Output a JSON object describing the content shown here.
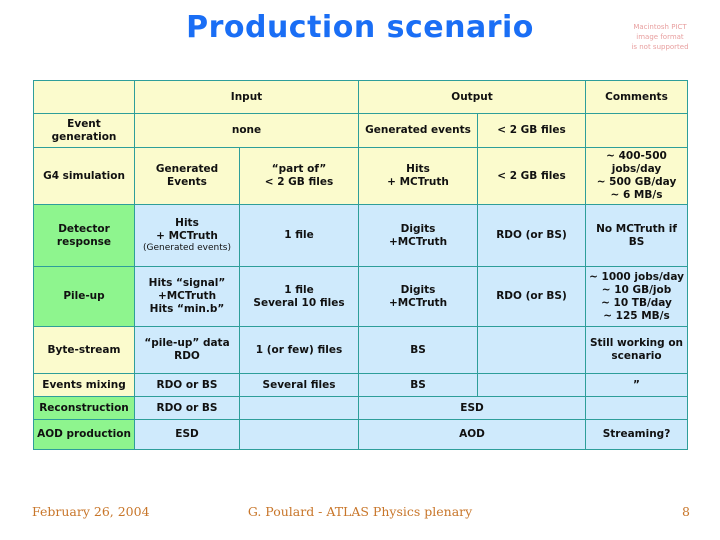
{
  "title": "Production scenario",
  "pict_placeholder": {
    "line1": "Macintosh PICT",
    "line2": "image format",
    "line3": "is not supported"
  },
  "colors": {
    "title": "#1a6ef5",
    "header_text": "#cc1111",
    "border": "#2e9e9a",
    "yellow": "#fbfbcd",
    "blue": "#cfeafc",
    "green": "#8ef58e",
    "footer": "#c8762a"
  },
  "table": {
    "headers": {
      "stage": "",
      "input": "Input",
      "output": "Output",
      "comments": "Comments"
    },
    "rows": [
      {
        "stage": "Event generation",
        "input_1": "none",
        "input_2": "",
        "output_1": "Generated events",
        "output_2": "< 2 GB files",
        "comments": ""
      },
      {
        "stage": "G4 simulation",
        "input_1": "Generated Events",
        "input_2": "“part of”\n< 2 GB files",
        "output_1": "Hits\n+ MCTruth",
        "output_2": "< 2 GB files",
        "comments": "~ 400-500 jobs/day\n~ 500 GB/day\n~ 6 MB/s"
      },
      {
        "stage": "Detector response",
        "input_1": "Hits\n+ MCTruth",
        "input_1_sub": "(Generated events)",
        "input_2": "1 file",
        "output_1": "Digits\n+MCTruth",
        "output_2": "RDO (or BS)",
        "comments": "No MCTruth if BS"
      },
      {
        "stage": "Pile-up",
        "input_1": "Hits “signal”\n+MCTruth\nHits “min.b”",
        "input_2": "1 file\nSeveral 10 files",
        "output_1": "Digits\n+MCTruth",
        "output_2": "RDO (or BS)",
        "comments": "~ 1000 jobs/day\n~ 10 GB/job\n~ 10 TB/day\n~ 125 MB/s"
      },
      {
        "stage": "Byte-stream",
        "input_1": "“pile-up” data\nRDO",
        "input_2": "1 (or few) files",
        "output_1": "BS",
        "output_2": "",
        "comments": "Still working on scenario"
      },
      {
        "stage": "Events mixing",
        "input_1": "RDO or BS",
        "input_2": "Several files",
        "output_1": "BS",
        "output_2": "",
        "comments": "”"
      },
      {
        "stage": "Reconstruction",
        "input_1": "RDO or BS",
        "input_2": "",
        "output_1": "ESD",
        "output_2": "",
        "comments": ""
      },
      {
        "stage": "AOD production",
        "input_1": "ESD",
        "input_2": "",
        "output_1": "AOD",
        "output_2": "",
        "comments": "Streaming?"
      }
    ]
  },
  "footer": {
    "date": "February 26, 2004",
    "center": "G. Poulard - ATLAS Physics plenary",
    "page": "8"
  }
}
